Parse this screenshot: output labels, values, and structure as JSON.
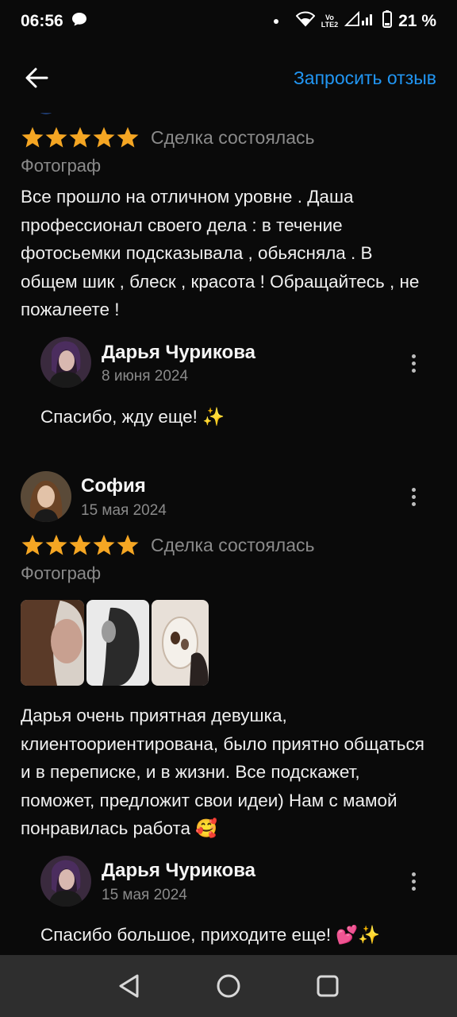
{
  "status": {
    "time": "06:56",
    "lte_top": "Vo",
    "lte_bottom": "LTE2",
    "battery": "21 %"
  },
  "header": {
    "request_review": "Запросить отзыв"
  },
  "reviews": [
    {
      "stars": 5,
      "deal": "Сделка состоялась",
      "category": "Фотограф",
      "text": "Все прошло на отличном уровне . Даша профессионал своего дела : в течение фотосьемки подсказывала , обьясняла . В общем шик , блеск , красота ! Обращайтесь , не пожалеете !",
      "reply": {
        "name": "Дарья Чурикова",
        "date": "8 июня 2024",
        "text": "Спасибо, жду еще! ✨"
      }
    },
    {
      "author": "София",
      "date": "15 мая 2024",
      "stars": 5,
      "deal": "Сделка состоялась",
      "category": "Фотограф",
      "text": "Дарья очень приятная девушка, клиентоориентирована, было приятно общаться и в переписке, и в жизни. Все подскажет, поможет, предложит свои идеи) Нам с мамой понравилась работа 🥰",
      "reply": {
        "name": "Дарья Чурикова",
        "date": "15 мая 2024",
        "text": "Спасибо большое, приходите еще! 💕✨"
      }
    }
  ],
  "colors": {
    "accent": "#2196f3",
    "star": "#f5a623",
    "background": "#0a0a0a",
    "muted": "#8a8a8a"
  }
}
